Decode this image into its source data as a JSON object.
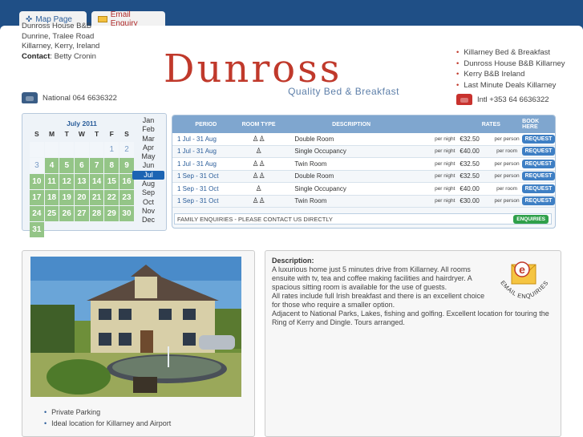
{
  "tabs": [
    {
      "label": "Map Page",
      "icon": "crosshair-icon"
    },
    {
      "label": "Email Enquiry",
      "icon": "envelope-icon"
    }
  ],
  "address": {
    "lines": [
      "Dunross House B&B",
      "Dunrine, Tralee Road",
      "Killarney, Kerry, Ireland"
    ],
    "contact_label": "Contact",
    "contact_name": "Betty Cronin"
  },
  "phones": {
    "national": "National 064 6636322",
    "intl": "Intl +353 64 6636322"
  },
  "logo": {
    "name": "Dunross",
    "tagline": "Quality Bed & Breakfast"
  },
  "links": [
    "Killarney Bed & Breakfast",
    "Dunross House B&B Killarney",
    "Kerry B&B Ireland",
    "Last Minute Deals Killarney"
  ],
  "calendar": {
    "title": "July 2011",
    "day_headers": [
      "S",
      "M",
      "T",
      "W",
      "T",
      "F",
      "S"
    ],
    "days": [
      {
        "n": "",
        "s": "blank"
      },
      {
        "n": "",
        "s": "blank"
      },
      {
        "n": "",
        "s": "blank"
      },
      {
        "n": "",
        "s": "blank"
      },
      {
        "n": "",
        "s": "blank"
      },
      {
        "n": "1",
        "s": "past"
      },
      {
        "n": "2",
        "s": "past"
      },
      {
        "n": "3",
        "s": "past"
      },
      {
        "n": "4",
        "s": "avail"
      },
      {
        "n": "5",
        "s": "avail"
      },
      {
        "n": "6",
        "s": "avail"
      },
      {
        "n": "7",
        "s": "avail"
      },
      {
        "n": "8",
        "s": "avail"
      },
      {
        "n": "9",
        "s": "avail"
      },
      {
        "n": "10",
        "s": "avail"
      },
      {
        "n": "11",
        "s": "avail"
      },
      {
        "n": "12",
        "s": "avail"
      },
      {
        "n": "13",
        "s": "avail"
      },
      {
        "n": "14",
        "s": "avail"
      },
      {
        "n": "15",
        "s": "avail"
      },
      {
        "n": "16",
        "s": "avail"
      },
      {
        "n": "17",
        "s": "avail"
      },
      {
        "n": "18",
        "s": "avail"
      },
      {
        "n": "19",
        "s": "avail"
      },
      {
        "n": "20",
        "s": "avail"
      },
      {
        "n": "21",
        "s": "avail"
      },
      {
        "n": "22",
        "s": "avail"
      },
      {
        "n": "23",
        "s": "avail"
      },
      {
        "n": "24",
        "s": "avail"
      },
      {
        "n": "25",
        "s": "avail"
      },
      {
        "n": "26",
        "s": "avail"
      },
      {
        "n": "27",
        "s": "avail"
      },
      {
        "n": "28",
        "s": "avail"
      },
      {
        "n": "29",
        "s": "avail"
      },
      {
        "n": "30",
        "s": "avail"
      },
      {
        "n": "31",
        "s": "avail"
      }
    ],
    "months": [
      "Jan",
      "Feb",
      "Mar",
      "Apr",
      "May",
      "Jun",
      "Jul",
      "Aug",
      "Sep",
      "Oct",
      "Nov",
      "Dec"
    ],
    "active_month": "Jul"
  },
  "rates": {
    "headers": {
      "period": "Period",
      "type": "Room Type",
      "desc": "Description",
      "rates": "Rates",
      "book": "Book Here"
    },
    "rows": [
      {
        "period": "1 Jul - 31 Aug",
        "icon": "two-persons-icon",
        "desc": "Double Room",
        "per_night": "per night",
        "rate": "€32.50",
        "per": "per person",
        "book": "REQUEST"
      },
      {
        "period": "1 Jul - 31 Aug",
        "icon": "one-person-icon",
        "desc": "Single Occupancy",
        "per_night": "per night",
        "rate": "€40.00",
        "per": "per room",
        "book": "REQUEST"
      },
      {
        "period": "1 Jul - 31 Aug",
        "icon": "two-persons-icon",
        "desc": "Twin Room",
        "per_night": "per night",
        "rate": "€32.50",
        "per": "per person",
        "book": "REQUEST"
      },
      {
        "period": "1 Sep - 31 Oct",
        "icon": "two-persons-icon",
        "desc": "Double Room",
        "per_night": "per night",
        "rate": "€32.50",
        "per": "per person",
        "book": "REQUEST"
      },
      {
        "period": "1 Sep - 31 Oct",
        "icon": "one-person-icon",
        "desc": "Single Occupancy",
        "per_night": "per night",
        "rate": "€40.00",
        "per": "per room",
        "book": "REQUEST"
      },
      {
        "period": "1 Sep - 31 Oct",
        "icon": "two-persons-icon",
        "desc": "Twin Room",
        "per_night": "per night",
        "rate": "€30.00",
        "per": "per person",
        "book": "REQUEST"
      }
    ],
    "family_text": "FAMILY ENQUIRIES - PLEASE CONTACT US DIRECTLY",
    "family_button": "ENQUIRIES"
  },
  "features": [
    "Private Parking",
    "Ideal location for Killarney and Airport"
  ],
  "description": {
    "label": "Description:",
    "paragraphs": [
      "A luxurious home just 5 minutes drive from Killarney. All rooms ensuite with tv, tea and coffee making facilities and hairdryer. A spacious sitting room is available for the use of guests.",
      "All rates include full Irish breakfast and there is an excellent choice for those who require a smaller option.",
      "Adjacent to National Parks, Lakes, fishing and golfing. Excellent location for touring the Ring of Kerry and Dingle. Tours arranged."
    ],
    "badge_letter": "e",
    "badge_text": "EMAIL ENQUIRIES"
  },
  "colors": {
    "brand_red": "#c0392b",
    "accent_blue": "#2a5d9a",
    "available_green": "#94c587",
    "page_bg": "#1f4f86"
  }
}
